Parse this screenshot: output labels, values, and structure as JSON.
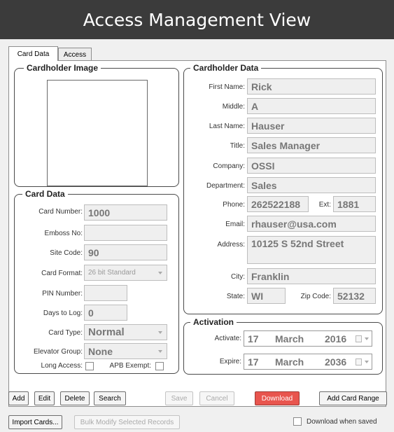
{
  "header": {
    "title": "Access Management View"
  },
  "tabs": [
    {
      "label": "Card Data"
    },
    {
      "label": "Access"
    }
  ],
  "cardholder_image": {
    "legend": "Cardholder Image"
  },
  "card_data": {
    "legend": "Card Data",
    "card_number": {
      "label": "Card Number:",
      "value": "1000"
    },
    "emboss_no": {
      "label": "Emboss No:",
      "value": ""
    },
    "site_code": {
      "label": "Site Code:",
      "value": "90"
    },
    "card_format": {
      "label": "Card Format:",
      "value": "26 bit Standard"
    },
    "pin_number": {
      "label": "PIN Number:",
      "value": ""
    },
    "days_to_log": {
      "label": "Days to Log:",
      "value": "0"
    },
    "card_type": {
      "label": "Card Type:",
      "value": "Normal"
    },
    "elevator_group": {
      "label": "Elevator Group:",
      "value": "None"
    },
    "long_access": {
      "label": "Long Access:",
      "checked": false
    },
    "apb_exempt": {
      "label": "APB Exempt:",
      "checked": false
    }
  },
  "cardholder_data": {
    "legend": "Cardholder Data",
    "first_name": {
      "label": "First Name:",
      "value": "Rick"
    },
    "middle": {
      "label": "Middle:",
      "value": "A"
    },
    "last_name": {
      "label": "Last Name:",
      "value": "Hauser"
    },
    "title": {
      "label": "Title:",
      "value": "Sales Manager"
    },
    "company": {
      "label": "Company:",
      "value": "OSSI"
    },
    "department": {
      "label": "Department:",
      "value": "Sales"
    },
    "phone": {
      "label": "Phone:",
      "value": "262522188"
    },
    "ext": {
      "label": "Ext:",
      "value": "1881"
    },
    "email": {
      "label": "Email:",
      "value": "rhauser@usa.com"
    },
    "address": {
      "label": "Address:",
      "value": "10125 S 52nd Street"
    },
    "city": {
      "label": "City:",
      "value": "Franklin"
    },
    "state": {
      "label": "State:",
      "value": "WI"
    },
    "zip": {
      "label": "Zip Code:",
      "value": "52132"
    }
  },
  "activation": {
    "legend": "Activation",
    "activate": {
      "label": "Activate:",
      "day": "17",
      "month": "March",
      "year": "2016"
    },
    "expire": {
      "label": "Expire:",
      "day": "17",
      "month": "March",
      "year": "2036"
    }
  },
  "buttons": {
    "add": "Add",
    "edit": "Edit",
    "delete": "Delete",
    "search": "Search",
    "save": "Save",
    "cancel": "Cancel",
    "download": "Download",
    "add_card_range": "Add Card Range",
    "import_cards": "Import Cards...",
    "bulk_modify": "Bulk Modify Selected Records"
  },
  "download_when_saved": {
    "label": "Download when saved",
    "checked": false
  },
  "colors": {
    "title_bar": "#3b3b3b",
    "download_button": "#e8554e"
  }
}
